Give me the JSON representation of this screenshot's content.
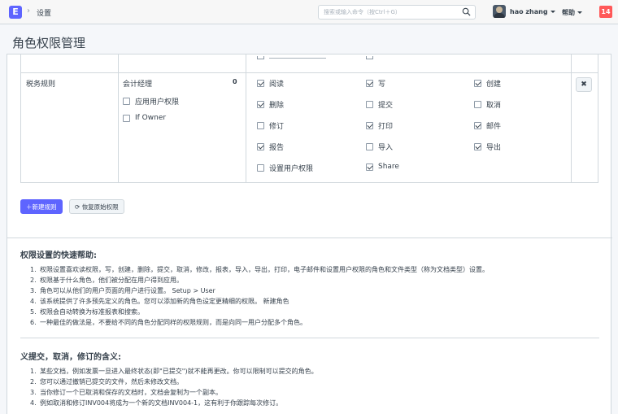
{
  "navbar": {
    "logo_letter": "E",
    "breadcrumb": "设置",
    "search_placeholder": "搜索或输入命令（按Ctrl＋G）",
    "user_name": "hao zhang",
    "help_label": "帮助",
    "notification_count": "14"
  },
  "page": {
    "title": "角色权限管理"
  },
  "rule": {
    "doctype": "税务规则",
    "role": "会计经理",
    "level": "0",
    "apply_user_permissions": {
      "label": "应用用户权限",
      "checked": false
    },
    "if_owner": {
      "label": "If Owner",
      "checked": false
    },
    "delete_icon": "close-icon",
    "permissions": [
      {
        "label": "阅读",
        "checked": true
      },
      {
        "label": "写",
        "checked": true
      },
      {
        "label": "创建",
        "checked": true
      },
      {
        "label": "删除",
        "checked": true
      },
      {
        "label": "提交",
        "checked": false
      },
      {
        "label": "取消",
        "checked": false
      },
      {
        "label": "修订",
        "checked": false
      },
      {
        "label": "打印",
        "checked": true
      },
      {
        "label": "邮件",
        "checked": true
      },
      {
        "label": "报告",
        "checked": true
      },
      {
        "label": "导入",
        "checked": false
      },
      {
        "label": "导出",
        "checked": true
      },
      {
        "label": "设置用户权限",
        "checked": false
      },
      {
        "label": "Share",
        "checked": true
      }
    ]
  },
  "actions": {
    "add_rule": "＋新建规则",
    "restore": "恢复原始权限"
  },
  "help1": {
    "title": "权限设置的快速帮助:",
    "items": [
      "权限设置喜欢读权限，写，创建，删除，提交，取消，修改，报表，导入，导出，打印，电子邮件和设置用户权限的角色和文件类型（称为文档类型）设置。",
      "权限基于什么角色，他们被分配在用户得到应用。",
      "角色可以从他们的用户页面的用户进行设置。 Setup > User",
      "该系统提供了许多预先定义的角色。您可以添加新的角色设定更精细的权限。 新建角色",
      "权限会自动转换为标准报表和搜索。",
      "一种最佳的做法是，不要给不同的角色分配同样的权限规则，而是向同一用户分配多个角色。"
    ]
  },
  "help2": {
    "title": "义提交，取消，修订的含义:",
    "items": [
      "某些文档，例如发票一旦进入最终状态(即\"已提交\")就不能再更改。你可以限制可以提交的角色。",
      "您可以通过撤销已提交的文件，然后未修改文档。",
      "当你修订一个已取消和保存的文档时，文档会复制为一个副本。",
      "例如取消和修订INV004将成为一个新的文档INV004-1，这有利于你跟踪每次修订。"
    ]
  },
  "colors": {
    "accent": "#5e64ff",
    "badge": "#ff5858"
  }
}
